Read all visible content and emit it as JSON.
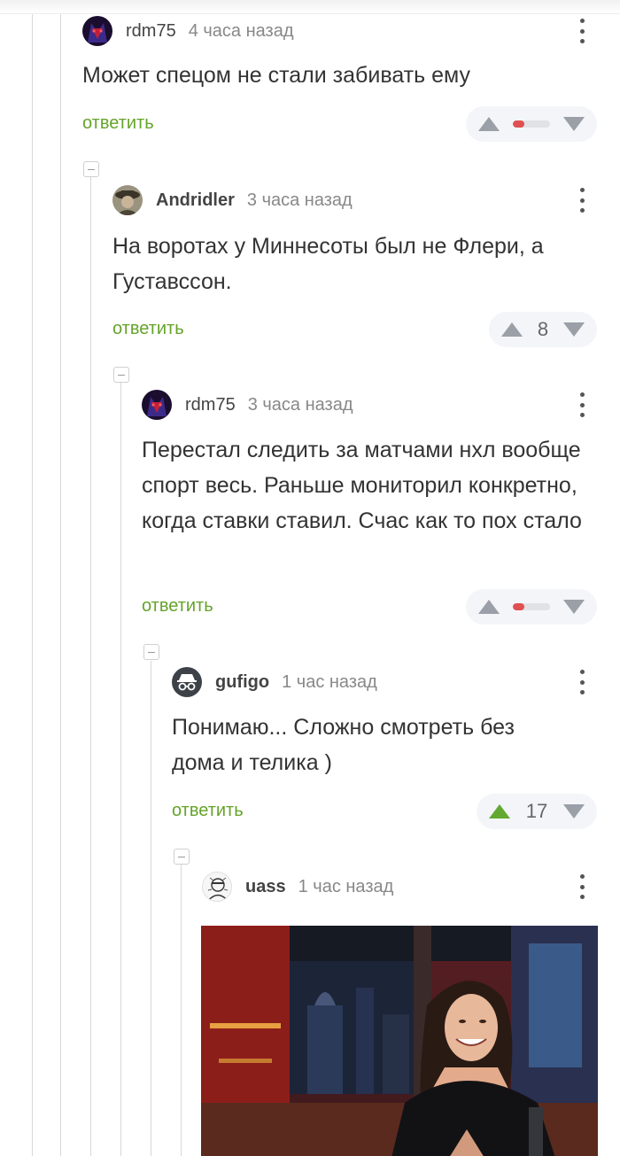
{
  "colors": {
    "accent_green": "#65a32a",
    "downvote_red": "#e05050",
    "rating_bg": "#f3f5f8"
  },
  "comments": [
    {
      "user": "rdm75",
      "time": "4 часа назад",
      "text": "Может спецом не стали забивать ему",
      "reply": "ответить",
      "rating": {
        "score": "",
        "bar_fraction": 0.3
      },
      "avatar": "wolf-avatar"
    },
    {
      "user": "Andridler",
      "time": "3 часа назад",
      "text": "На воротах у Миннесоты был не Флери, а Густавссон.",
      "reply": "ответить",
      "rating": {
        "score": "8"
      },
      "avatar": "soldier-avatar"
    },
    {
      "user": "rdm75",
      "time": "3 часа назад",
      "text": "Перестал следить за матчами нхл вообще спорт весь. Раньше мониторил конкретно, когда ставки ставил. Счас как то пох стало",
      "reply": "ответить",
      "rating": {
        "score": "",
        "bar_fraction": 0.3
      },
      "avatar": "wolf-avatar"
    },
    {
      "user": "gufigo",
      "time": "1 час назад",
      "text": "Понимаю... Сложно смотреть без дома и телика )",
      "reply": "ответить",
      "rating": {
        "score": "17",
        "upvoted": true
      },
      "avatar": "incognito-avatar"
    },
    {
      "user": "uass",
      "time": "1 час назад",
      "avatar": "sketch-avatar",
      "image": "laughing-woman-gif"
    }
  ]
}
